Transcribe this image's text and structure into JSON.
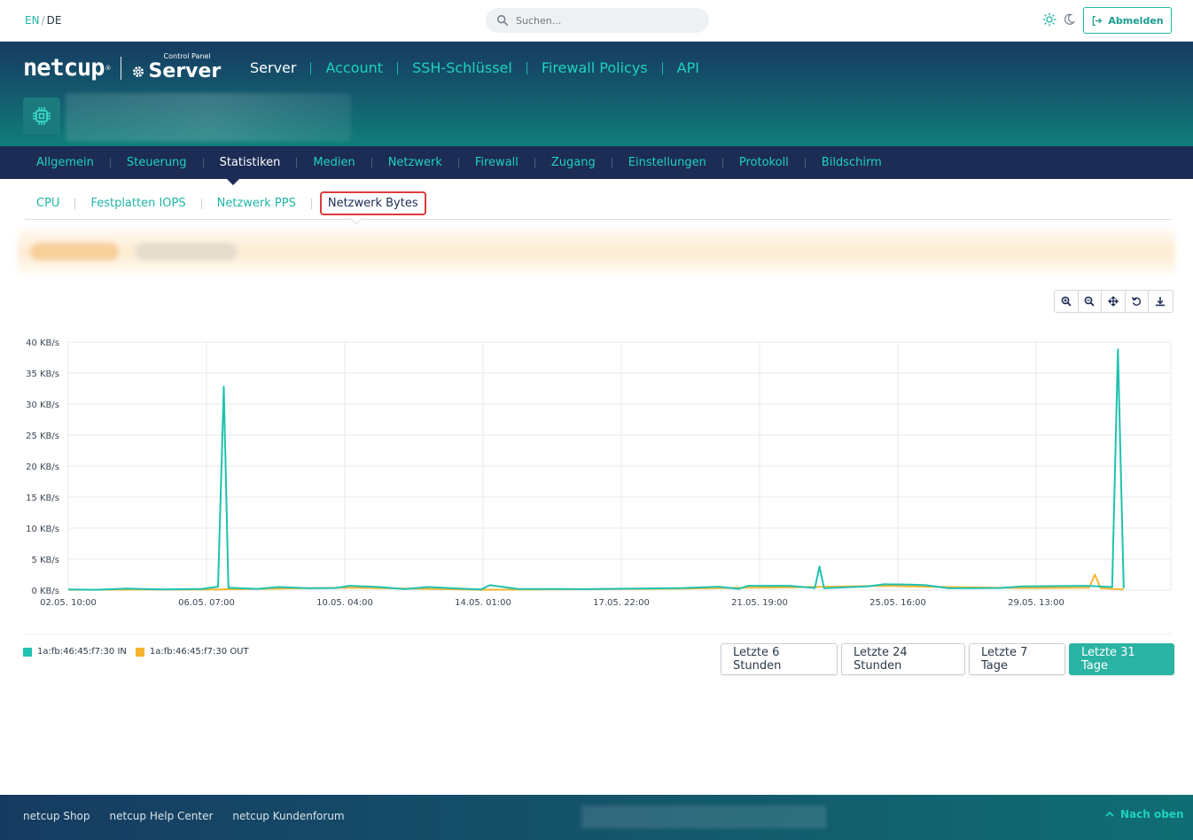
{
  "topbar": {
    "lang_en": "EN",
    "lang_sep": "/",
    "lang_de": "DE",
    "search_placeholder": "Suchen...",
    "logout_label": "Abmelden"
  },
  "brand": {
    "name": "netcup",
    "reg": "®",
    "control_panel": "Control Panel",
    "product": "Server"
  },
  "main_nav": [
    "Server",
    "Account",
    "SSH-Schlüssel",
    "Firewall Policys",
    "API"
  ],
  "sub_nav": [
    "Allgemein",
    "Steuerung",
    "Statistiken",
    "Medien",
    "Netzwerk",
    "Firewall",
    "Zugang",
    "Einstellungen",
    "Protokoll",
    "Bildschirm"
  ],
  "tabs": [
    "CPU",
    "Festplatten IOPS",
    "Netzwerk PPS",
    "Netzwerk Bytes"
  ],
  "chart_data": {
    "type": "line",
    "y_ticks": [
      "0 KB/s",
      "5 KB/s",
      "10 KB/s",
      "15 KB/s",
      "20 KB/s",
      "25 KB/s",
      "30 KB/s",
      "35 KB/s",
      "40 KB/s"
    ],
    "ylim": [
      0,
      40
    ],
    "y_unit": "KB/s",
    "x_ticks": [
      "02.05. 10:00",
      "06.05. 07:00",
      "10.05. 04:00",
      "14.05. 01:00",
      "17.05. 22:00",
      "21.05. 19:00",
      "25.05. 16:00",
      "29.05. 13:00"
    ],
    "grid": true,
    "legend_position": "bottom-left",
    "series": [
      {
        "name": "1a:fb:46:45:f7:30 IN",
        "color": "#1fc2b0",
        "points": [
          [
            0,
            0.1
          ],
          [
            1.2,
            0.05
          ],
          [
            2.5,
            0.25
          ],
          [
            4.1,
            0.1
          ],
          [
            5.8,
            0.2
          ],
          [
            6.5,
            0.55
          ],
          [
            6.75,
            32.8
          ],
          [
            6.95,
            0.4
          ],
          [
            8.2,
            0.2
          ],
          [
            9.1,
            0.5
          ],
          [
            10.5,
            0.3
          ],
          [
            11.6,
            0.35
          ],
          [
            12.2,
            0.7
          ],
          [
            13.5,
            0.5
          ],
          [
            14.6,
            0.15
          ],
          [
            15.6,
            0.5
          ],
          [
            17.9,
            0.1
          ],
          [
            18.3,
            0.8
          ],
          [
            19.5,
            0.2
          ],
          [
            22.4,
            0.15
          ],
          [
            26.7,
            0.35
          ],
          [
            28.2,
            0.55
          ],
          [
            29.1,
            0.2
          ],
          [
            29.5,
            0.7
          ],
          [
            31.3,
            0.7
          ],
          [
            32.4,
            0.35
          ],
          [
            32.6,
            3.8
          ],
          [
            32.8,
            0.3
          ],
          [
            34.7,
            0.6
          ],
          [
            35.4,
            0.95
          ],
          [
            36.5,
            0.9
          ],
          [
            37.2,
            0.8
          ],
          [
            38.2,
            0.3
          ],
          [
            40.4,
            0.35
          ],
          [
            41.4,
            0.6
          ],
          [
            44.2,
            0.7
          ],
          [
            44.7,
            0.6
          ],
          [
            45.3,
            0.5
          ],
          [
            45.55,
            38.8
          ],
          [
            45.8,
            0.3
          ]
        ]
      },
      {
        "name": "1a:fb:46:45:f7:30 OUT",
        "color": "#f5b52e",
        "points": [
          [
            0,
            0.05
          ],
          [
            6.5,
            0.1
          ],
          [
            12.2,
            0.4
          ],
          [
            17.9,
            0.05
          ],
          [
            26.7,
            0.25
          ],
          [
            29.5,
            0.4
          ],
          [
            31.3,
            0.45
          ],
          [
            35.4,
            0.7
          ],
          [
            37.2,
            0.55
          ],
          [
            41.4,
            0.35
          ],
          [
            44.3,
            0.4
          ],
          [
            44.55,
            2.5
          ],
          [
            44.8,
            0.3
          ],
          [
            45.8,
            0.1
          ]
        ]
      }
    ]
  },
  "ranges": [
    "Letzte 6 Stunden",
    "Letzte 24 Stunden",
    "Letzte 7 Tage",
    "Letzte 31 Tage"
  ],
  "footer": {
    "links": [
      "netcup Shop",
      "netcup Help Center",
      "netcup Kundenforum"
    ],
    "to_top": "Nach oben"
  }
}
